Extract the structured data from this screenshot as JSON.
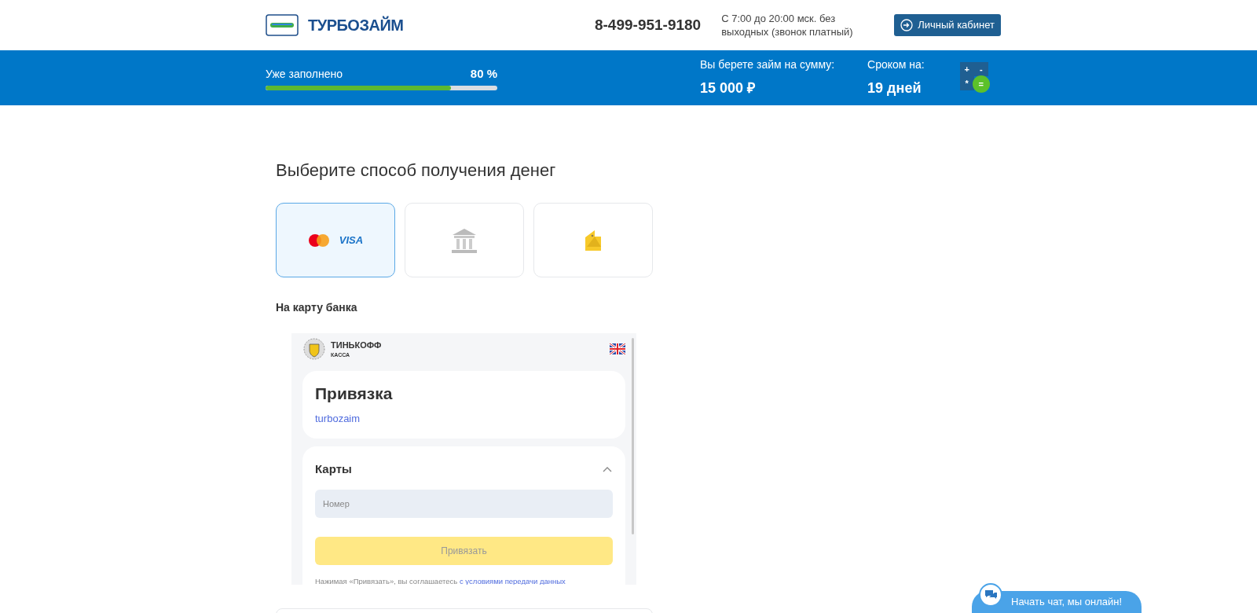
{
  "header": {
    "logo_text": "ТУРБОЗАЙМ",
    "phone": "8-499-951-9180",
    "hours": "С 7:00 до 20:00 мск. без выходных (звонок платный)",
    "account_button": "Личный кабинет"
  },
  "status_bar": {
    "progress_label": "Уже заполнено",
    "progress_reading": "80 %",
    "level": 0.8,
    "amount_label": "Вы берете займ на сумму:",
    "amount": "15 000 ₽",
    "term_label": "Сроком на:",
    "term": "19 дней",
    "calculator_keys": [
      "+",
      "-",
      "*",
      "="
    ]
  },
  "heading": "Выберите способ получения денег",
  "methods": [
    {
      "kind": "card",
      "selected": true,
      "brand": "VISA"
    },
    {
      "kind": "bank",
      "selected": false
    },
    {
      "kind": "wallet",
      "selected": false
    }
  ],
  "method_title": "На карту банка",
  "payment_frame": {
    "brand": "ТИНЬКОФФ",
    "brand_sub": "КАССА",
    "title": "Привязка",
    "merchant": "turbozaim",
    "section_title": "Карты",
    "expanded": true,
    "card_placeholder": "Номер",
    "submit_button": "Привязать",
    "consent_text": "Нажимая «Привязать», вы соглашаетесь",
    "consent_link": "с условиями передачи данных"
  },
  "chat_button": "Начать чат, мы онлайн!"
}
